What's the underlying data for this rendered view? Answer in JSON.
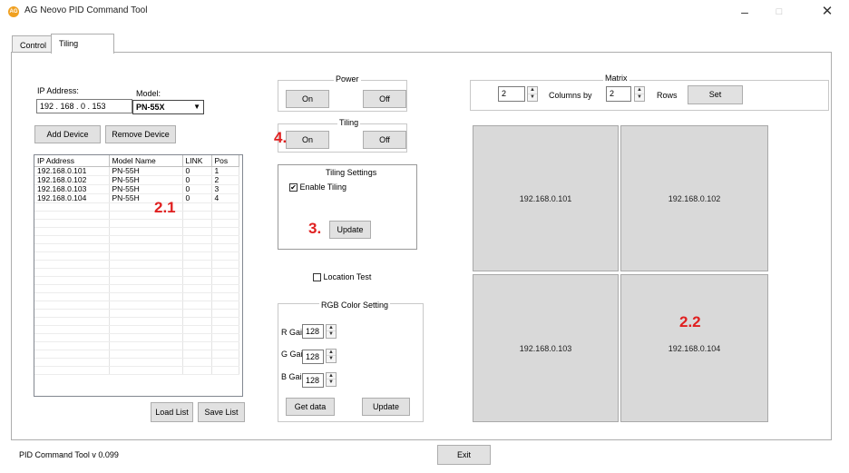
{
  "window": {
    "title": "AG Neovo PID Command Tool",
    "icon_text": "AG",
    "minimize": "–",
    "maximize": "□",
    "close": "✕"
  },
  "tabs": [
    {
      "label": "Control",
      "active": false
    },
    {
      "label": "Tiling",
      "active": true
    }
  ],
  "connection": {
    "ip_label": "IP Address:",
    "ip_value": "192 . 168 .  0  . 153",
    "model_label": "Model:",
    "model_value": "PN-55X",
    "add_button": "Add Device",
    "remove_button": "Remove Device"
  },
  "device_list": {
    "columns": [
      "IP Address",
      "Model Name",
      "LINK",
      "Pos"
    ],
    "rows": [
      [
        "192.168.0.101",
        "PN-55H",
        "0",
        "1"
      ],
      [
        "192.168.0.102",
        "PN-55H",
        "0",
        "2"
      ],
      [
        "192.168.0.103",
        "PN-55H",
        "0",
        "3"
      ],
      [
        "192.168.0.104",
        "PN-55H",
        "0",
        "4"
      ]
    ],
    "load_button": "Load List",
    "save_button": "Save List"
  },
  "power": {
    "title": "Power",
    "on": "On",
    "off": "Off"
  },
  "tiling": {
    "title": "Tiling",
    "on": "On",
    "off": "Off"
  },
  "tiling_settings": {
    "title": "Tiling Settings",
    "enable_label": "Enable Tiling",
    "enable_checked": true,
    "update_button": "Update"
  },
  "location_test": {
    "label": "Location Test",
    "checked": false
  },
  "rgb": {
    "title": "RGB Color Setting",
    "r_label": "R Gain",
    "r_value": "128",
    "g_label": "G Gain",
    "g_value": "128",
    "b_label": "B Gain",
    "b_value": "128",
    "get_button": "Get data",
    "update_button": "Update"
  },
  "matrix": {
    "title": "Matrix",
    "columns_value": "2",
    "columns_label": "Columns by",
    "rows_value": "2",
    "rows_label": "Rows",
    "set_button": "Set",
    "tiles": [
      "192.168.0.101",
      "192.168.0.102",
      "192.168.0.103",
      "192.168.0.104"
    ]
  },
  "annotations": {
    "a21": "2.1",
    "a22": "2.2",
    "a3": "3.",
    "a4": "4."
  },
  "status": {
    "version": "PID Command Tool v 0.099",
    "exit_button": "Exit"
  },
  "colors": {
    "annotation": "#e02020",
    "tile_bg": "#d9d9d9",
    "button_face": "#e1e1e1",
    "default_button_border": "#0078d7"
  }
}
